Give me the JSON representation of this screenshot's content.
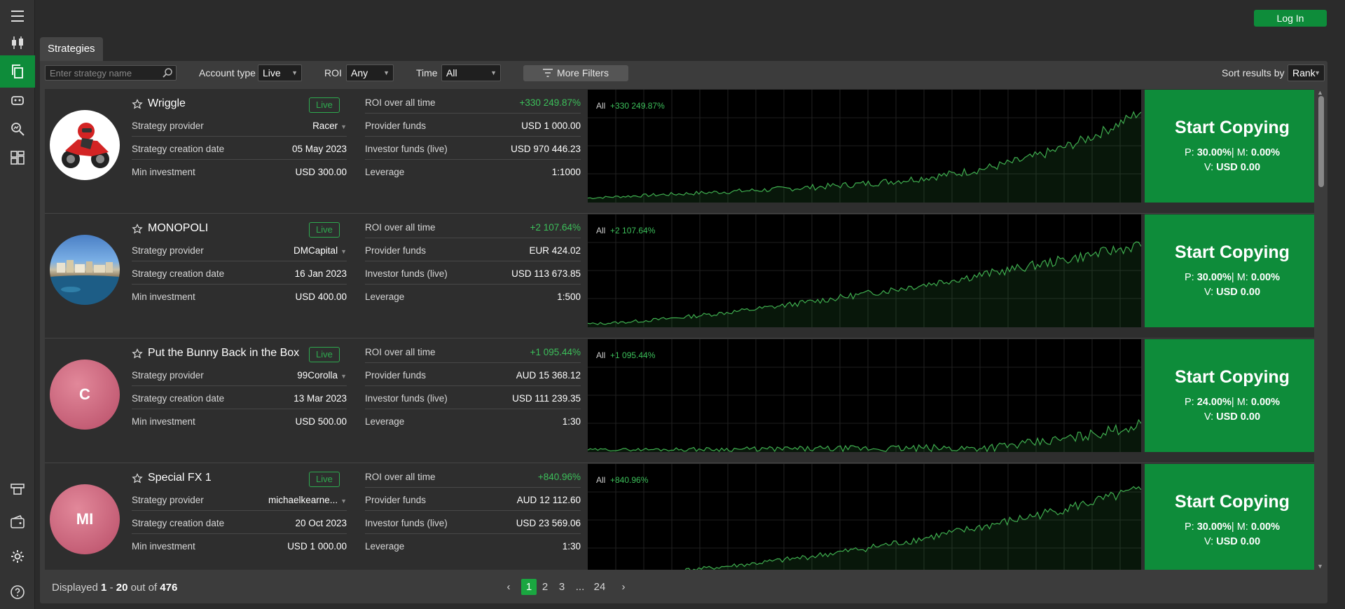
{
  "auth": {
    "login_label": "Log In"
  },
  "tabs": {
    "strategies": "Strategies"
  },
  "filters": {
    "search_placeholder": "Enter strategy name",
    "account_type_label": "Account type",
    "account_type_value": "Live",
    "roi_label": "ROI",
    "roi_value": "Any",
    "time_label": "Time",
    "time_value": "All",
    "more_filters": "More Filters",
    "sort_label": "Sort results by",
    "sort_value": "Rank"
  },
  "labels": {
    "provider": "Strategy provider",
    "created": "Strategy creation date",
    "min_inv": "Min investment",
    "roi": "ROI over all time",
    "prov_funds": "Provider funds",
    "inv_funds": "Investor funds (live)",
    "leverage": "Leverage",
    "live_badge": "Live",
    "chart_all": "All",
    "start_copying": "Start Copying",
    "p": "P:",
    "m": "| M:",
    "vol": "V:"
  },
  "strategies": [
    {
      "name": "Wriggle",
      "provider": "Racer",
      "created": "05 May 2023",
      "min_investment": "USD 300.00",
      "roi": "+330 249.87%",
      "provider_funds": "USD 1 000.00",
      "investor_funds": "USD 970 446.23",
      "leverage": "1:1000",
      "p": "30.00%",
      "m": "0.00%",
      "v": "USD 0.00",
      "avatar": "motorbike-rider",
      "avatar_text": ""
    },
    {
      "name": "MONOPOLI",
      "provider": "DMCapital",
      "created": "16 Jan 2023",
      "min_investment": "USD 400.00",
      "roi": "+2 107.64%",
      "provider_funds": "EUR 424.02",
      "investor_funds": "USD 113 673.85",
      "leverage": "1:500",
      "p": "30.00%",
      "m": "0.00%",
      "v": "USD 0.00",
      "avatar": "harbour-photo",
      "avatar_text": ""
    },
    {
      "name": "Put the Bunny Back in the Box",
      "provider": "99Corolla",
      "created": "13 Mar 2023",
      "min_investment": "USD 500.00",
      "roi": "+1 095.44%",
      "provider_funds": "AUD 15 368.12",
      "investor_funds": "USD 111 239.35",
      "leverage": "1:30",
      "p": "24.00%",
      "m": "0.00%",
      "v": "USD 0.00",
      "avatar": "initials",
      "avatar_text": "C"
    },
    {
      "name": "Special FX 1",
      "provider": "michaelkearne...",
      "created": "20 Oct 2023",
      "min_investment": "USD 1 000.00",
      "roi": "+840.96%",
      "provider_funds": "AUD 12 112.60",
      "investor_funds": "USD 23 569.06",
      "leverage": "1:30",
      "p": "30.00%",
      "m": "0.00%",
      "v": "USD 0.00",
      "avatar": "initials",
      "avatar_text": "MI"
    }
  ],
  "pagination": {
    "displayed_label": "Displayed",
    "range_from": "1",
    "range_sep": "-",
    "range_to": "20",
    "out_of_label": "out of",
    "total": "476",
    "pages": [
      "1",
      "2",
      "3",
      "...",
      "24"
    ],
    "current": "1"
  },
  "colors": {
    "accent": "#0e8c3a",
    "positive": "#3cbf5a",
    "chart_line": "#3fae4f"
  }
}
